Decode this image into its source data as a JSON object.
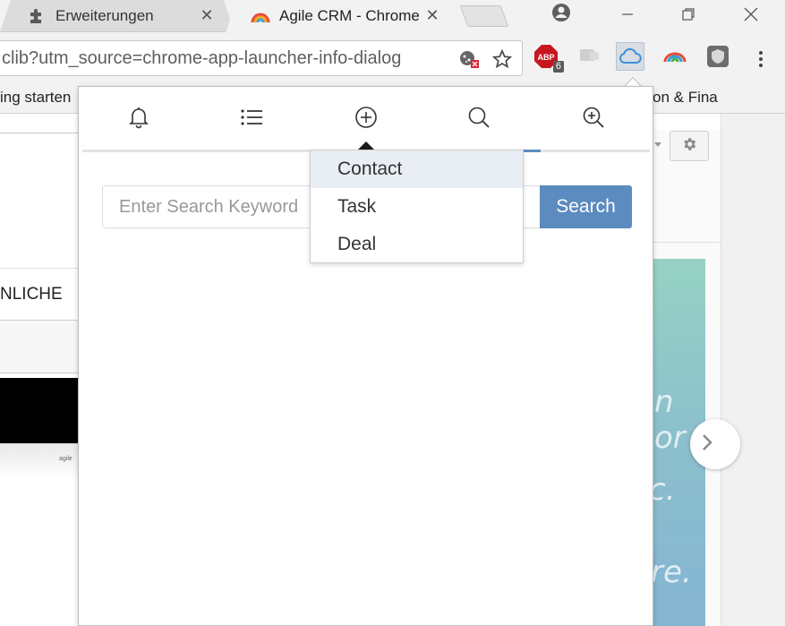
{
  "browser": {
    "tabs": [
      {
        "title": "Erweiterungen",
        "icon": "puzzle-icon",
        "active": false
      },
      {
        "title": "Agile CRM - Chrome",
        "icon": "agile-rainbow-icon",
        "active": true
      }
    ],
    "tab_close_glyph": "✕",
    "url": "clib?utm_source=chrome-app-launcher-info-dialog",
    "abp_badge": "6",
    "bookmarks": {
      "left_text": "ing starten",
      "right_text": "on & Fina"
    }
  },
  "page": {
    "left_heading": "NLICHE",
    "left_tiny_text": "agile",
    "banner_texts": [
      "n or",
      "c.",
      "re."
    ]
  },
  "popup": {
    "nav": [
      {
        "name": "notifications",
        "icon": "bell-icon"
      },
      {
        "name": "tasks",
        "icon": "list-icon"
      },
      {
        "name": "add",
        "icon": "plus-circle-icon"
      },
      {
        "name": "search",
        "icon": "search-icon"
      },
      {
        "name": "zoom",
        "icon": "zoom-in-icon"
      }
    ],
    "add_menu": [
      "Contact",
      "Task",
      "Deal"
    ],
    "add_menu_highlighted": "Contact",
    "search": {
      "placeholder": "Enter Search Keyword",
      "value": "",
      "button_label": "Search"
    },
    "colors": {
      "accent": "#5b8bbf",
      "dropdown_highlight": "#e9edf4"
    }
  }
}
